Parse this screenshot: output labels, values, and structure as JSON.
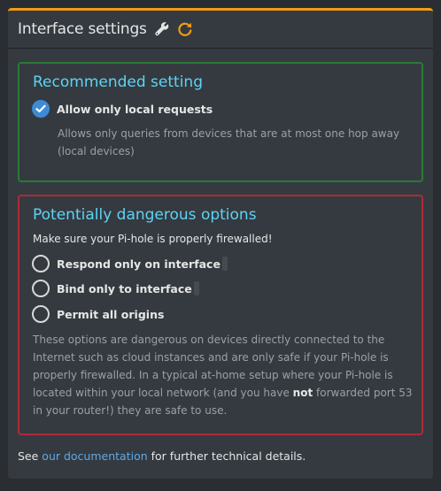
{
  "panel": {
    "title": "Interface settings",
    "accent_color": "#f39c12",
    "icons": [
      "wrench-icon",
      "refresh-icon"
    ]
  },
  "recommended": {
    "title": "Recommended setting",
    "border_color": "#28a745",
    "option": {
      "label": "Allow only local requests",
      "checked": true,
      "description": "Allows only queries from devices that are at most one hop away (local devices)"
    }
  },
  "dangerous": {
    "title": "Potentially dangerous options",
    "border_color": "#dc3545",
    "warning": "Make sure your Pi-hole is properly firewalled!",
    "options": [
      {
        "label": "Respond only on interface",
        "checked": false
      },
      {
        "label": "Bind only to interface",
        "checked": false
      },
      {
        "label": "Permit all origins",
        "checked": false
      }
    ],
    "description_before": "These options are dangerous on devices directly connected to the Internet such as cloud instances and are only safe if your Pi-hole is properly firewalled. In a typical at-home setup where your Pi-hole is located within your local network (and you have ",
    "description_bold": "not",
    "description_after": " forwarded port 53 in your router!) they are safe to use."
  },
  "footer": {
    "prefix": "See ",
    "link_text": "our documentation",
    "suffix": " for further technical details."
  }
}
